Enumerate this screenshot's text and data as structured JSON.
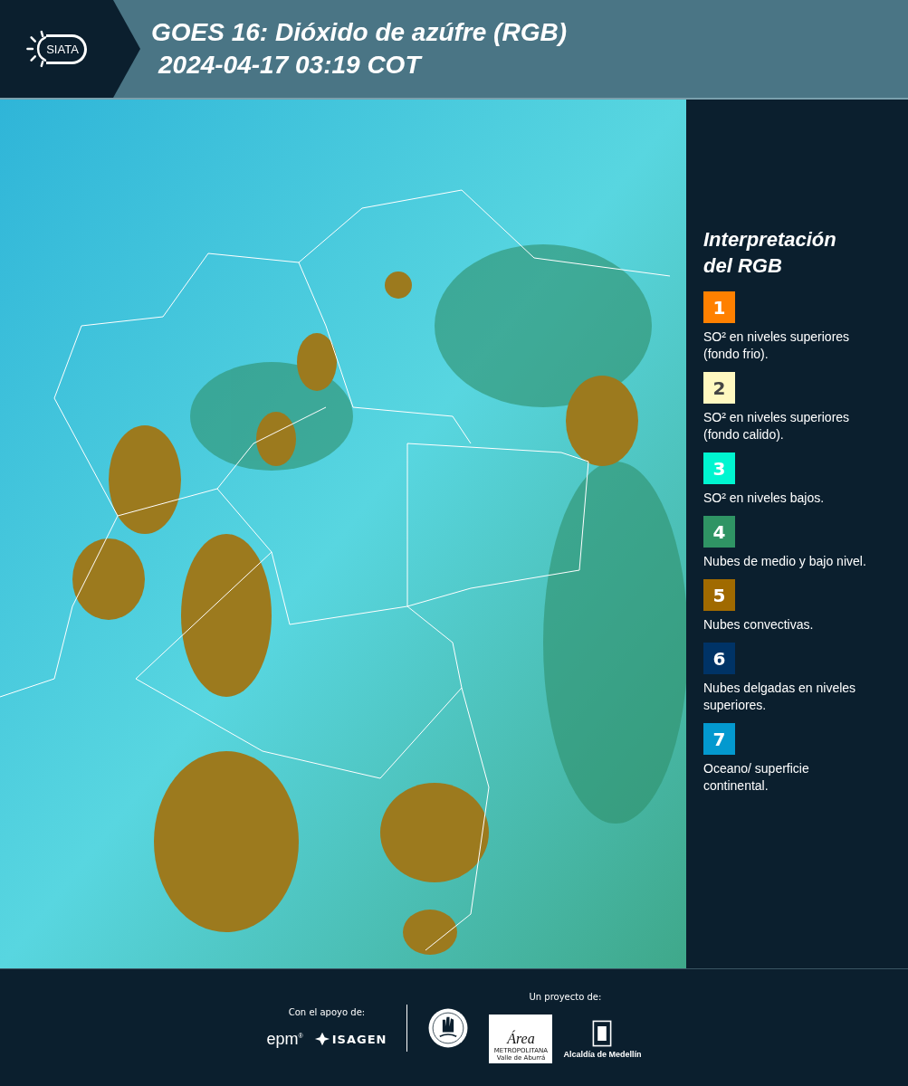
{
  "header": {
    "logo_text": "SIATA",
    "title": "GOES 16: Dióxido de azúfre (RGB)",
    "subtitle": "2024-04-17 03:19 COT"
  },
  "legend": {
    "title": "Interpretación del RGB",
    "items": [
      {
        "number": "1",
        "color": "#ff8000",
        "text": "SO² en niveles superiores (fondo frio)."
      },
      {
        "number": "2",
        "color": "#fff8c0",
        "text": "SO² en niveles superiores (fondo calido)."
      },
      {
        "number": "3",
        "color": "#00f5d0",
        "text": "SO² en niveles bajos."
      },
      {
        "number": "4",
        "color": "#2f9464",
        "text": "Nubes de medio y bajo nivel."
      },
      {
        "number": "5",
        "color": "#a06a00",
        "text": "Nubes convectivas."
      },
      {
        "number": "6",
        "color": "#003366",
        "text": "Nubes delgadas en niveles superiores."
      },
      {
        "number": "7",
        "color": "#0399cf",
        "text": "Oceano/ superficie continental."
      }
    ]
  },
  "footer": {
    "support_label": "Con el apoyo de:",
    "epm": "epm",
    "epm_mark": "®",
    "isagen": "ISAGEN",
    "project_label": "Un proyecto de:",
    "area_title": "Área",
    "area_line1": "METROPOLITANA",
    "area_line2": "Valle de Aburrá",
    "alcaldia": "Alcaldía de Medellín"
  }
}
